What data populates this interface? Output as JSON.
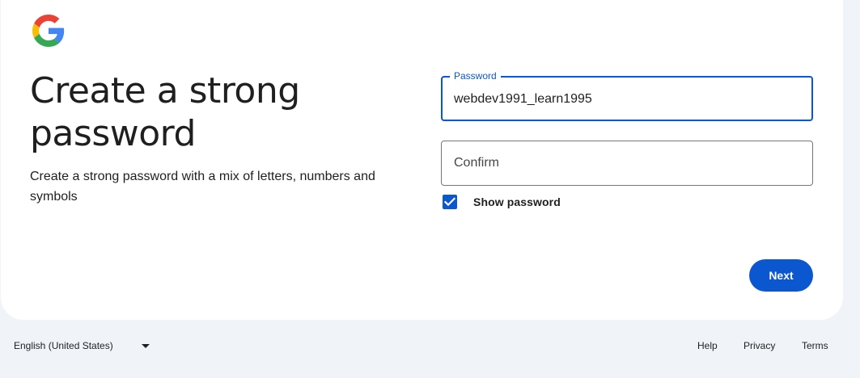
{
  "page": {
    "title": "Create a strong password",
    "subtitle": "Create a strong password with a mix of letters, numbers and symbols"
  },
  "logo": {
    "icon": "google-g-logo",
    "colors": [
      "#4285F4",
      "#EA4335",
      "#FBBC05",
      "#34A853"
    ]
  },
  "form": {
    "password": {
      "label": "Password",
      "value": "webdev1991_learn1995"
    },
    "confirm": {
      "placeholder": "Confirm",
      "value": ""
    },
    "show_password": {
      "label": "Show password",
      "checked": true
    },
    "next_label": "Next"
  },
  "footer": {
    "language": "English (United States)",
    "links": {
      "help": "Help",
      "privacy": "Privacy",
      "terms": "Terms"
    }
  },
  "colors": {
    "accent": "#0b57d0",
    "background": "#f0f4f9",
    "card": "#ffffff"
  }
}
